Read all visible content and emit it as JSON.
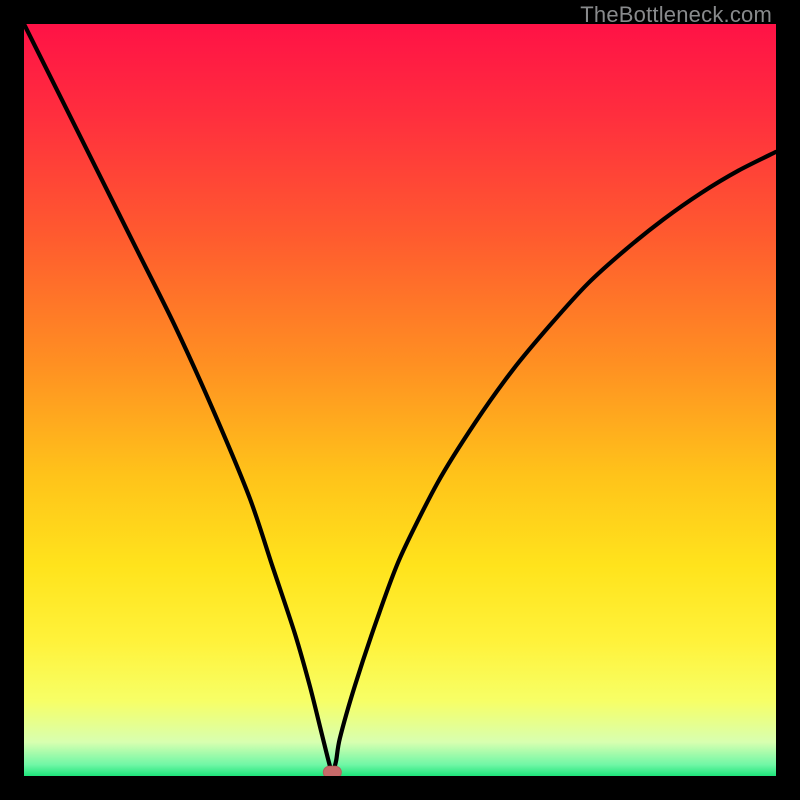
{
  "watermark": "TheBottleneck.com",
  "colors": {
    "frame": "#000000",
    "gradient_stops": [
      {
        "offset": 0.0,
        "color": "#ff1246"
      },
      {
        "offset": 0.12,
        "color": "#ff2e3e"
      },
      {
        "offset": 0.28,
        "color": "#ff5a2f"
      },
      {
        "offset": 0.45,
        "color": "#ff8f22"
      },
      {
        "offset": 0.6,
        "color": "#ffc31a"
      },
      {
        "offset": 0.72,
        "color": "#ffe31c"
      },
      {
        "offset": 0.82,
        "color": "#fff23a"
      },
      {
        "offset": 0.9,
        "color": "#f7ff66"
      },
      {
        "offset": 0.955,
        "color": "#d8ffb0"
      },
      {
        "offset": 0.985,
        "color": "#70f7a6"
      },
      {
        "offset": 1.0,
        "color": "#1de47a"
      }
    ],
    "curve": "#000000",
    "marker_fill": "#c76a6a",
    "marker_stroke": "#b85c5c"
  },
  "chart_data": {
    "type": "line",
    "title": "",
    "xlabel": "",
    "ylabel": "",
    "xlim": [
      0,
      100
    ],
    "ylim": [
      0,
      100
    ],
    "series": [
      {
        "name": "bottleneck-curve",
        "x": [
          0,
          5,
          10,
          15,
          20,
          25,
          30,
          33,
          36,
          38,
          39.5,
          40.5,
          41,
          41.5,
          42,
          44,
          47,
          50,
          55,
          60,
          65,
          70,
          75,
          80,
          85,
          90,
          95,
          100
        ],
        "y": [
          100,
          90,
          80,
          70,
          60,
          49,
          37,
          28,
          19,
          12,
          6,
          2,
          0.5,
          2,
          5,
          12,
          21,
          29,
          39,
          47,
          54,
          60,
          65.5,
          70,
          74,
          77.5,
          80.5,
          83
        ]
      }
    ],
    "marker": {
      "x": 41,
      "y": 0.5
    }
  }
}
